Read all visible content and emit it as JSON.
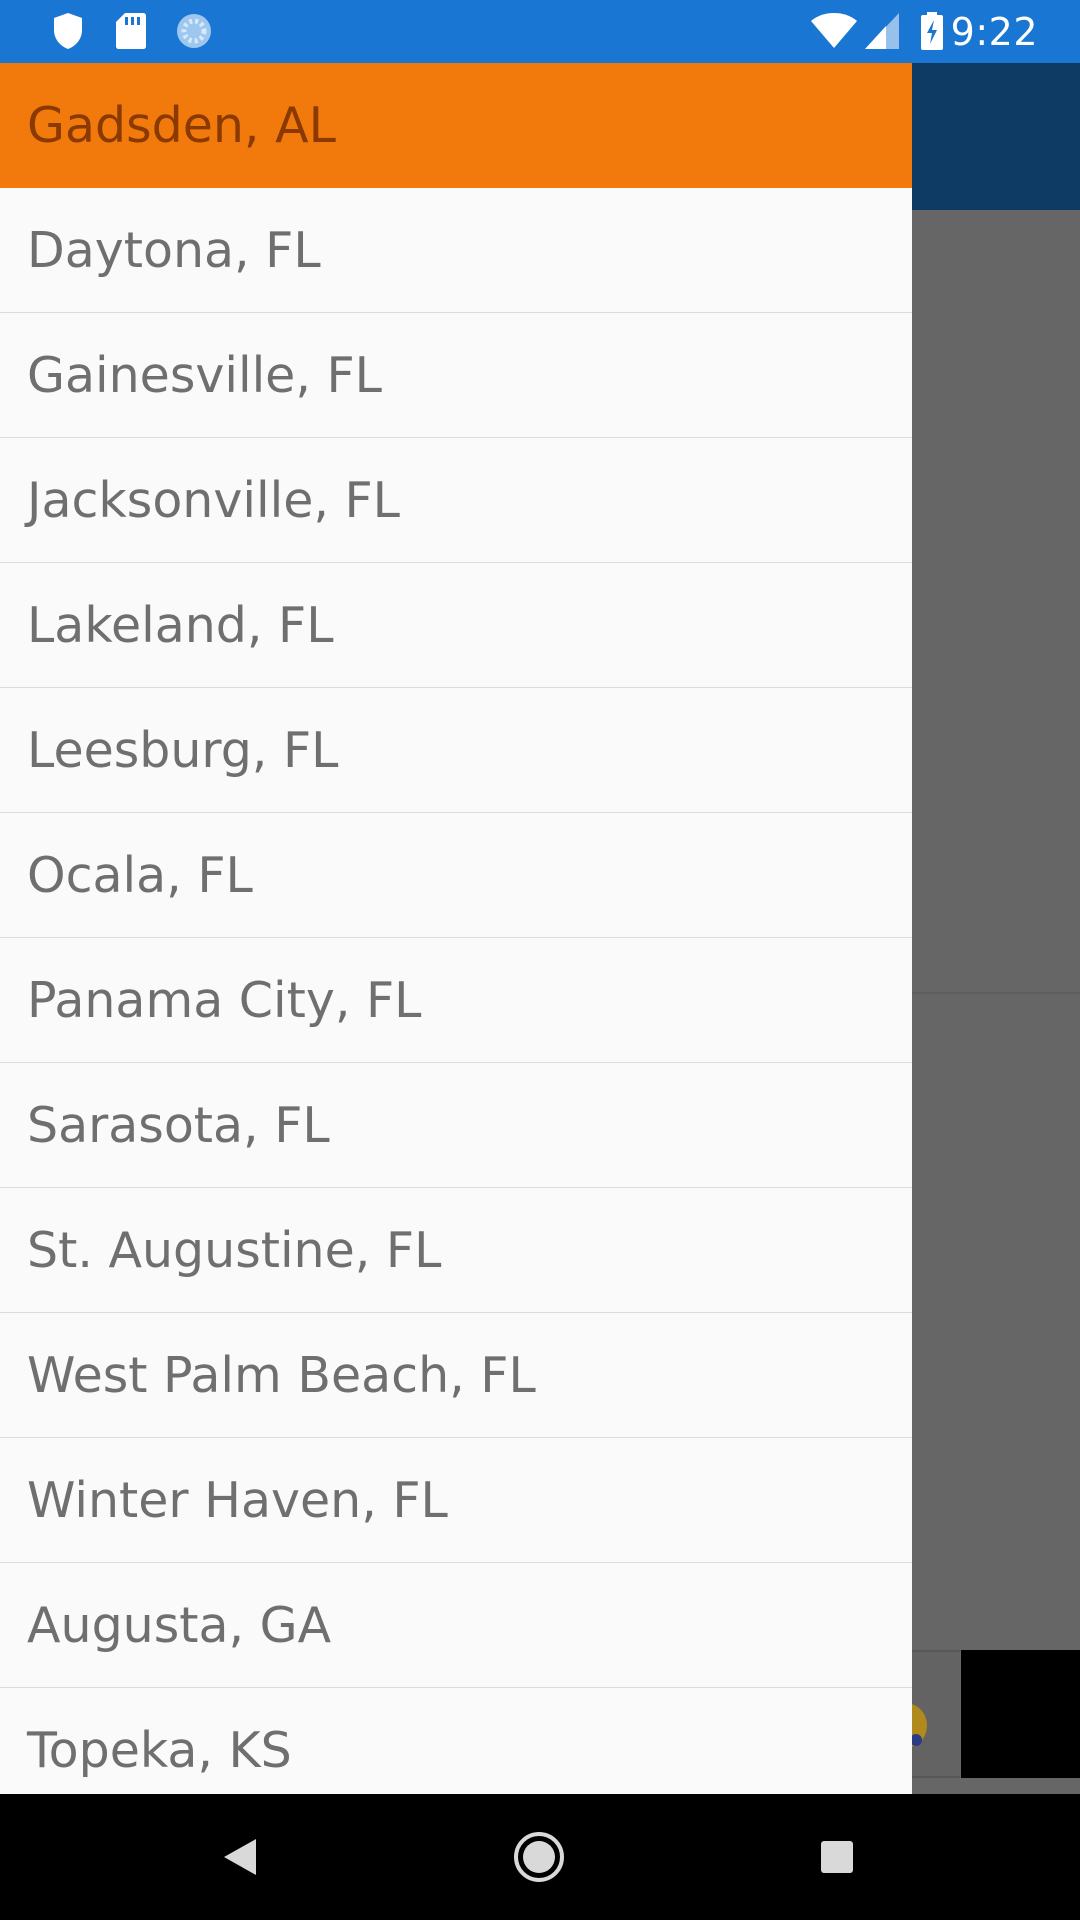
{
  "status_bar": {
    "time": "9:22",
    "left_icons": [
      "shield-icon",
      "sd-card-icon",
      "loading-icon"
    ],
    "right_icons": [
      "wifi-icon",
      "signal-icon",
      "battery-charging-icon"
    ],
    "color": "#1976d2"
  },
  "drawer": {
    "selected_index": 0,
    "accent_color": "#f27a0c",
    "items": [
      "Gadsden, AL",
      "Daytona, FL",
      "Gainesville, FL",
      "Jacksonville, FL",
      "Lakeland, FL",
      "Leesburg, FL",
      "Ocala, FL",
      "Panama City, FL",
      "Sarasota, FL",
      "St. Augustine, FL",
      "West Palm Beach, FL",
      "Winter Haven, FL",
      "Augusta, GA",
      "Topeka, KS"
    ]
  },
  "nav_bar": {
    "buttons": [
      "back-icon",
      "home-icon",
      "recents-icon"
    ]
  }
}
